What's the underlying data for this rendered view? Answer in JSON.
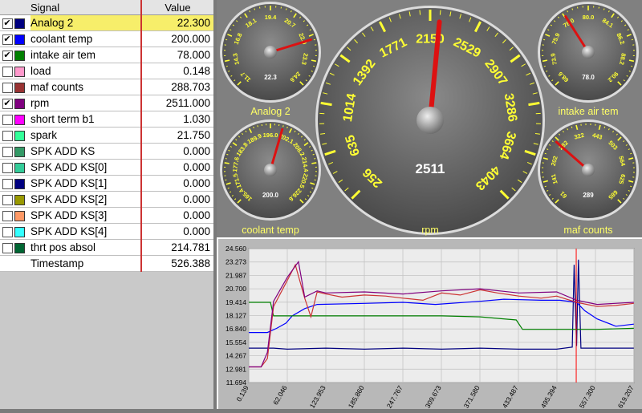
{
  "table": {
    "header_signal": "Signal",
    "header_value": "Value",
    "rows": [
      {
        "checked": true,
        "color": "#000080",
        "name": "Analog 2",
        "value": "22.300",
        "selected": true
      },
      {
        "checked": true,
        "color": "#0000ff",
        "name": "coolant temp",
        "value": "200.000"
      },
      {
        "checked": true,
        "color": "#008000",
        "name": "intake air tem",
        "value": "78.000"
      },
      {
        "checked": false,
        "color": "#ff99cc",
        "name": "load",
        "value": "0.148"
      },
      {
        "checked": false,
        "color": "#993333",
        "name": "maf counts",
        "value": "288.703"
      },
      {
        "checked": true,
        "color": "#800080",
        "name": "rpm",
        "value": "2511.000"
      },
      {
        "checked": false,
        "color": "#ff00ff",
        "name": "short term b1",
        "value": "1.030"
      },
      {
        "checked": false,
        "color": "#33ff99",
        "name": "spark",
        "value": "21.750"
      },
      {
        "checked": false,
        "color": "#339966",
        "name": "SPK ADD KS",
        "value": "0.000"
      },
      {
        "checked": false,
        "color": "#33cc99",
        "name": "SPK ADD KS[0]",
        "value": "0.000"
      },
      {
        "checked": false,
        "color": "#000080",
        "name": "SPK ADD KS[1]",
        "value": "0.000"
      },
      {
        "checked": false,
        "color": "#999900",
        "name": "SPK ADD KS[2]",
        "value": "0.000"
      },
      {
        "checked": false,
        "color": "#ff9966",
        "name": "SPK ADD KS[3]",
        "value": "0.000"
      },
      {
        "checked": false,
        "color": "#33ffff",
        "name": "SPK ADD KS[4]",
        "value": "0.000"
      },
      {
        "checked": false,
        "color": "#006633",
        "name": "thrt pos absol",
        "value": "214.781"
      }
    ],
    "timestamp_label": "Timestamp",
    "timestamp_value": "526.388"
  },
  "gauges": [
    {
      "key": "analog2",
      "label": "Analog 2",
      "readout": "22.3",
      "ticks": [
        "11.7",
        "14.3",
        "16.8",
        "18.1",
        "19.4",
        "20.7",
        "22.0",
        "23.3",
        "24.6"
      ],
      "needle_value": "22.3",
      "needle_fraction": 0.77
    },
    {
      "key": "coolant",
      "label": "coolant temp",
      "readout": "200.0",
      "ticks": [
        "165.4",
        "171.5",
        "177.6",
        "183.8",
        "189.9",
        "196.0",
        "202.1",
        "208.2",
        "214.4",
        "220.5",
        "226.6"
      ],
      "needle_value": "200.0",
      "needle_fraction": 0.56
    },
    {
      "key": "rpm",
      "label": "rpm",
      "readout": "2511",
      "ticks": [
        "256",
        "635",
        "1014",
        "1392",
        "1771",
        "2150",
        "2529",
        "2907",
        "3286",
        "3664",
        "4043"
      ],
      "needle_value": "2511",
      "needle_fraction": 0.52
    },
    {
      "key": "iat",
      "label": "intake air tem",
      "readout": "78.0",
      "ticks": [
        "68.6",
        "73.9",
        "75.9",
        "78.0",
        "80.0",
        "84.1",
        "86.2",
        "88.2",
        "90.2"
      ],
      "needle_value": "78.0",
      "needle_fraction": 0.38
    },
    {
      "key": "maf",
      "label": "maf counts",
      "readout": "289",
      "ticks": [
        "61",
        "141",
        "202",
        "282",
        "322",
        "443",
        "503",
        "564",
        "625",
        "685"
      ],
      "needle_value": "289",
      "needle_fraction": 0.32
    }
  ],
  "chart_data": {
    "type": "line",
    "ylim": [
      11.694,
      24.56
    ],
    "xlim": [
      0.139,
      619.207
    ],
    "ytick_labels": [
      "24.560",
      "23.273",
      "21.987",
      "20.700",
      "19.414",
      "18.127",
      "16.840",
      "15.554",
      "14.267",
      "12.981",
      "11.694"
    ],
    "xtick_labels": [
      "0.139",
      "62.046",
      "123.953",
      "185.860",
      "247.767",
      "309.673",
      "371.580",
      "433.487",
      "495.394",
      "557.300",
      "619.207"
    ],
    "cursor_x": 526.388,
    "series": [
      {
        "color": "#000080",
        "values": [
          [
            0.1,
            15.0
          ],
          [
            40,
            15.0
          ],
          [
            62,
            14.9
          ],
          [
            124,
            15.0
          ],
          [
            186,
            14.9
          ],
          [
            248,
            15.0
          ],
          [
            310,
            14.9
          ],
          [
            372,
            15.0
          ],
          [
            434,
            14.9
          ],
          [
            495,
            14.9
          ],
          [
            520,
            15.1
          ],
          [
            523,
            23.0
          ],
          [
            527,
            15.2
          ],
          [
            530,
            23.5
          ],
          [
            534,
            15.0
          ],
          [
            560,
            15.0
          ],
          [
            619,
            15.0
          ]
        ]
      },
      {
        "color": "#0000ff",
        "values": [
          [
            0.1,
            16.5
          ],
          [
            30,
            16.5
          ],
          [
            45,
            16.9
          ],
          [
            60,
            17.4
          ],
          [
            70,
            18.1
          ],
          [
            90,
            18.8
          ],
          [
            110,
            19.2
          ],
          [
            186,
            19.3
          ],
          [
            248,
            19.4
          ],
          [
            300,
            19.2
          ],
          [
            372,
            19.5
          ],
          [
            410,
            19.7
          ],
          [
            470,
            19.6
          ],
          [
            500,
            19.6
          ],
          [
            527,
            19.4
          ],
          [
            540,
            18.6
          ],
          [
            560,
            17.8
          ],
          [
            590,
            17.1
          ],
          [
            619,
            17.3
          ]
        ]
      },
      {
        "color": "#008000",
        "values": [
          [
            0.1,
            19.4
          ],
          [
            35,
            19.4
          ],
          [
            40,
            18.1
          ],
          [
            124,
            18.1
          ],
          [
            186,
            18.1
          ],
          [
            248,
            18.1
          ],
          [
            310,
            18.1
          ],
          [
            372,
            18.0
          ],
          [
            430,
            17.7
          ],
          [
            440,
            16.8
          ],
          [
            500,
            16.8
          ],
          [
            560,
            16.8
          ],
          [
            619,
            16.9
          ]
        ]
      },
      {
        "color": "#cc3333",
        "values": [
          [
            0.1,
            13.2
          ],
          [
            20,
            13.2
          ],
          [
            30,
            14.0
          ],
          [
            40,
            19.0
          ],
          [
            62,
            21.5
          ],
          [
            75,
            23.0
          ],
          [
            90,
            19.8
          ],
          [
            100,
            18.0
          ],
          [
            110,
            20.4
          ],
          [
            124,
            20.2
          ],
          [
            150,
            19.9
          ],
          [
            186,
            20.1
          ],
          [
            220,
            20.0
          ],
          [
            248,
            19.8
          ],
          [
            280,
            19.6
          ],
          [
            310,
            20.3
          ],
          [
            340,
            20.1
          ],
          [
            372,
            20.6
          ],
          [
            400,
            20.3
          ],
          [
            434,
            20.0
          ],
          [
            470,
            19.8
          ],
          [
            495,
            20.0
          ],
          [
            527,
            19.4
          ],
          [
            560,
            19.0
          ],
          [
            590,
            19.1
          ],
          [
            619,
            19.3
          ]
        ]
      },
      {
        "color": "#800080",
        "values": [
          [
            0.1,
            13.2
          ],
          [
            20,
            13.2
          ],
          [
            30,
            14.6
          ],
          [
            40,
            19.5
          ],
          [
            62,
            21.8
          ],
          [
            80,
            23.3
          ],
          [
            90,
            19.9
          ],
          [
            110,
            20.5
          ],
          [
            124,
            20.3
          ],
          [
            186,
            20.4
          ],
          [
            248,
            20.2
          ],
          [
            310,
            20.5
          ],
          [
            372,
            20.7
          ],
          [
            434,
            20.3
          ],
          [
            495,
            20.4
          ],
          [
            527,
            19.6
          ],
          [
            560,
            19.2
          ],
          [
            619,
            19.4
          ]
        ]
      }
    ]
  }
}
